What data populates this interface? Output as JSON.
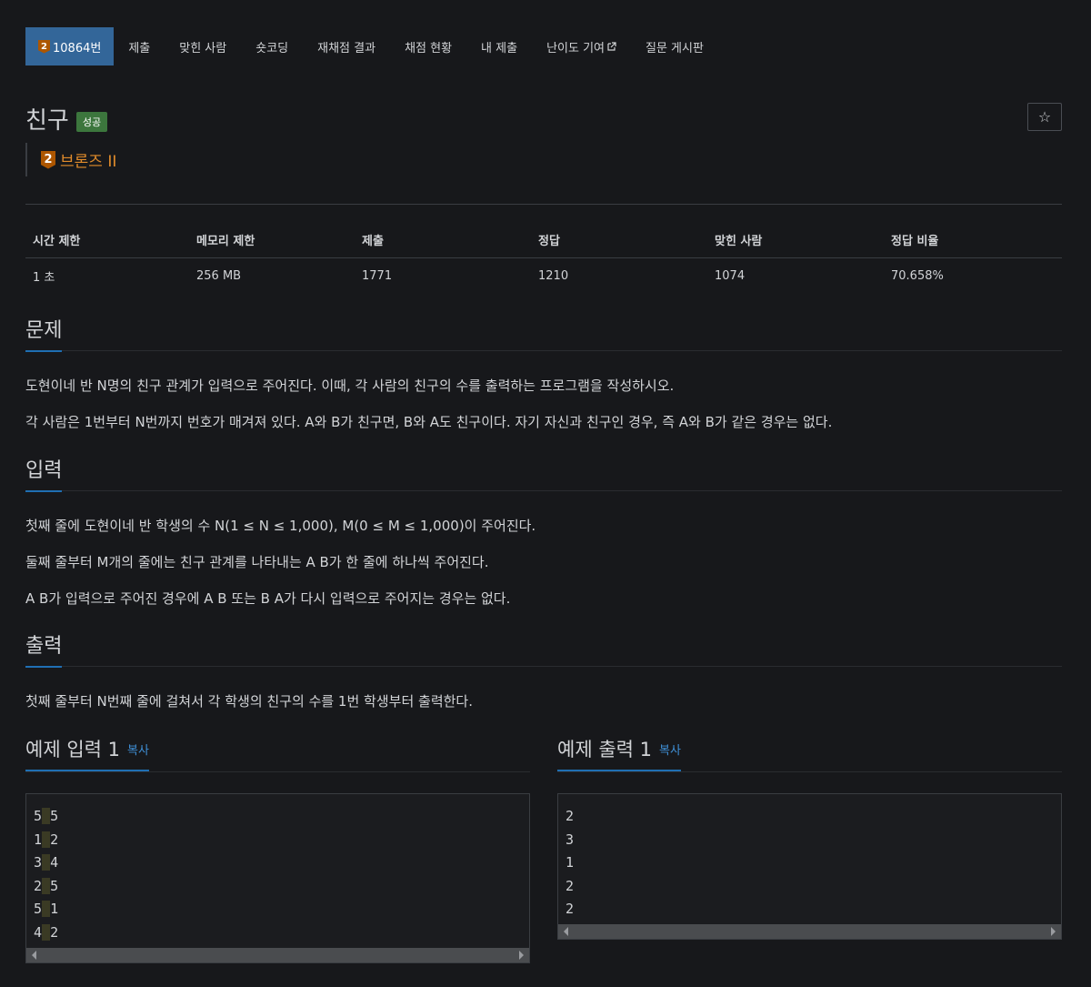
{
  "nav": {
    "problem_tier_number": "2",
    "items": [
      {
        "label": "10864번"
      },
      {
        "label": "제출"
      },
      {
        "label": "맞힌 사람"
      },
      {
        "label": "숏코딩"
      },
      {
        "label": "재채점 결과"
      },
      {
        "label": "채점 현황"
      },
      {
        "label": "내 제출"
      },
      {
        "label": "난이도 기여"
      },
      {
        "label": "질문 게시판"
      }
    ]
  },
  "problem": {
    "title": "친구",
    "status_badge": "성공",
    "star_icon": "☆",
    "tier_number": "2",
    "tier_name": "브론즈 II",
    "tier_color": "#ad5600"
  },
  "info": {
    "headers": [
      "시간 제한",
      "메모리 제한",
      "제출",
      "정답",
      "맞힌 사람",
      "정답 비율"
    ],
    "values": [
      "1 초",
      "256 MB",
      "1771",
      "1210",
      "1074",
      "70.658%"
    ]
  },
  "description": {
    "heading": "문제",
    "paragraphs": [
      "도현이네 반 N명의 친구 관계가 입력으로 주어진다. 이때, 각 사람의 친구의 수를 출력하는 프로그램을 작성하시오.",
      "각 사람은 1번부터 N번까지 번호가 매겨져 있다. A와 B가 친구면, B와 A도 친구이다. 자기 자신과 친구인 경우, 즉 A와 B가 같은 경우는 없다."
    ]
  },
  "input": {
    "heading": "입력",
    "paragraphs": [
      "첫째 줄에 도현이네 반 학생의 수 N(1 ≤ N ≤ 1,000), M(0 ≤ M ≤ 1,000)이 주어진다.",
      "둘째 줄부터 M개의 줄에는 친구 관계를 나타내는 A B가 한 줄에 하나씩 주어진다.",
      "A B가 입력으로 주어진 경우에 A B 또는 B A가 다시 입력으로 주어지는 경우는 없다."
    ]
  },
  "output": {
    "heading": "출력",
    "paragraphs": [
      "첫째 줄부터 N번째 줄에 걸쳐서 각 학생의 친구의 수를 1번 학생부터 출력한다."
    ]
  },
  "sample_input": {
    "heading": "예제 입력 1",
    "copy_label": "복사",
    "lines": [
      [
        "5",
        "5"
      ],
      [
        "1",
        "2"
      ],
      [
        "3",
        "4"
      ],
      [
        "2",
        "5"
      ],
      [
        "5",
        "1"
      ],
      [
        "4",
        "2"
      ]
    ]
  },
  "sample_output": {
    "heading": "예제 출력 1",
    "copy_label": "복사",
    "lines": [
      "2",
      "3",
      "1",
      "2",
      "2"
    ]
  },
  "colors": {
    "background": "#17181b",
    "nav_active": "#336699",
    "success_badge": "#3c763d",
    "link": "#3f8fd6",
    "section_underline": "#1f6fb3"
  }
}
